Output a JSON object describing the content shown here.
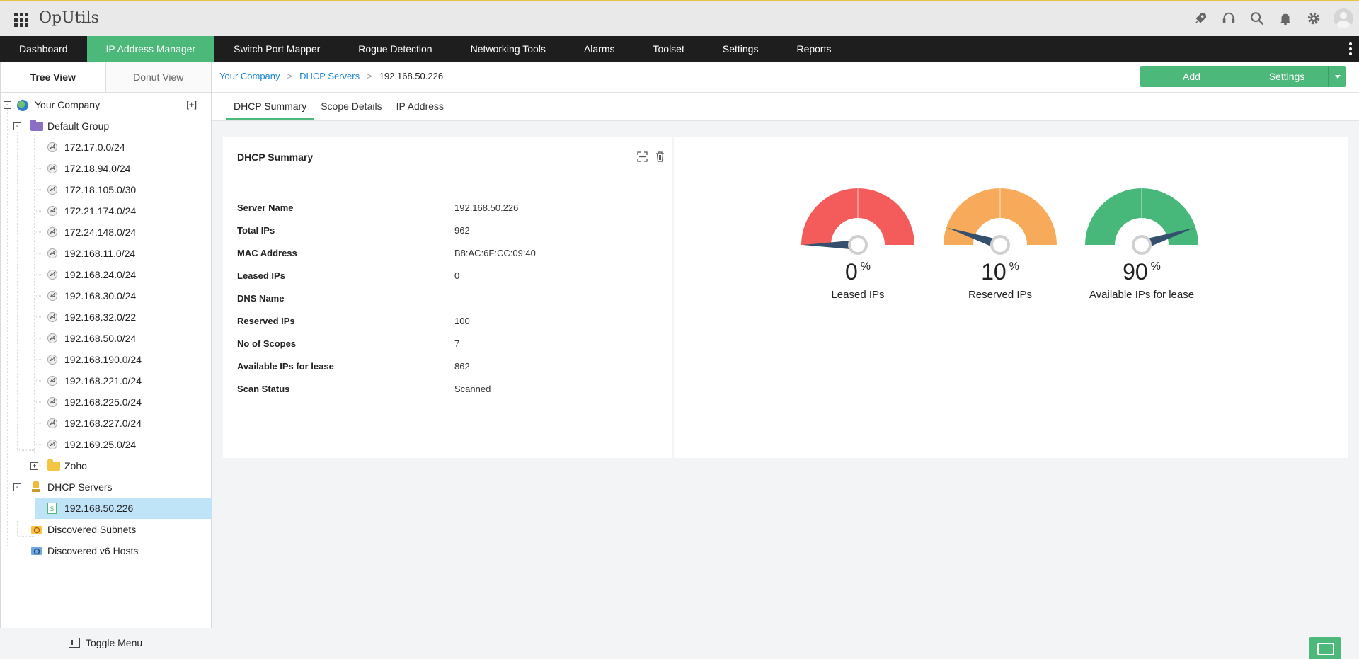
{
  "app": {
    "brand": "OpUtils"
  },
  "topbar": {
    "icons": [
      "rocket-icon",
      "headset-icon",
      "search-icon",
      "bell-icon",
      "gear-icon",
      "avatar-icon"
    ]
  },
  "mainnav": {
    "items": [
      {
        "label": "Dashboard",
        "active": false
      },
      {
        "label": "IP Address Manager",
        "active": true
      },
      {
        "label": "Switch Port Mapper",
        "active": false
      },
      {
        "label": "Rogue Detection",
        "active": false
      },
      {
        "label": "Networking Tools",
        "active": false
      },
      {
        "label": "Alarms",
        "active": false
      },
      {
        "label": "Toolset",
        "active": false
      },
      {
        "label": "Settings",
        "active": false
      },
      {
        "label": "Reports",
        "active": false
      }
    ]
  },
  "leftpanel": {
    "tabs": [
      {
        "label": "Tree View",
        "active": true
      },
      {
        "label": "Donut View",
        "active": false
      }
    ],
    "tree": {
      "root": "Your Company",
      "root_ctrl": "[+]  -",
      "default_group": "Default Group",
      "subnets": [
        "172.17.0.0/24",
        "172.18.94.0/24",
        "172.18.105.0/30",
        "172.21.174.0/24",
        "172.24.148.0/24",
        "192.168.11.0/24",
        "192.168.24.0/24",
        "192.168.30.0/24",
        "192.168.32.0/22",
        "192.168.50.0/24",
        "192.168.190.0/24",
        "192.168.221.0/24",
        "192.168.225.0/24",
        "192.168.227.0/24",
        "192.169.25.0/24"
      ],
      "v4_badge": "v4",
      "zoho": "Zoho",
      "dhcp_servers": "DHCP Servers",
      "dhcp_server_item": "192.168.50.226",
      "discovered_subnets": "Discovered Subnets",
      "discovered_v6": "Discovered v6 Hosts"
    },
    "toggle_menu": "Toggle Menu"
  },
  "breadcrumb": {
    "items": [
      "Your Company",
      "DHCP Servers"
    ],
    "current": "192.168.50.226",
    "separator": ">"
  },
  "actions": {
    "add": "Add",
    "settings": "Settings"
  },
  "subtabs": [
    {
      "label": "DHCP Summary",
      "active": true
    },
    {
      "label": "Scope Details",
      "active": false
    },
    {
      "label": "IP Address",
      "active": false
    }
  ],
  "summary": {
    "title": "DHCP Summary",
    "rows": [
      {
        "key": "Server Name",
        "value": "192.168.50.226"
      },
      {
        "key": "Total IPs",
        "value": "962"
      },
      {
        "key": "MAC Address",
        "value": "B8:AC:6F:CC:09:40"
      },
      {
        "key": "Leased IPs",
        "value": "0"
      },
      {
        "key": "DNS Name",
        "value": ""
      },
      {
        "key": "Reserved IPs",
        "value": "100"
      },
      {
        "key": "No of Scopes",
        "value": "7"
      },
      {
        "key": "Available IPs for lease",
        "value": "862"
      },
      {
        "key": "Scan Status",
        "value": "Scanned"
      }
    ]
  },
  "gauges": [
    {
      "value": 0,
      "unit": "%",
      "label": "Leased IPs",
      "color": "#f45b5b"
    },
    {
      "value": 10,
      "unit": "%",
      "label": "Reserved IPs",
      "color": "#f7ab5a"
    },
    {
      "value": 90,
      "unit": "%",
      "label": "Available IPs for lease",
      "color": "#47b87a"
    }
  ],
  "colors": {
    "accent": "#4cb87a",
    "link": "#1a86d0",
    "nav_bg": "#1e1e1e",
    "selected_row": "#bfe4f7",
    "needle": "#35506f"
  }
}
